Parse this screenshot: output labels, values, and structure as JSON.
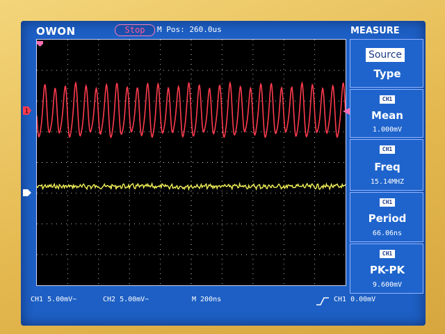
{
  "header": {
    "brand": "OWON",
    "run_state": "Stop",
    "m_pos": "M Pos: 260.0us",
    "mode_title": "MEASURE"
  },
  "menu": {
    "source": {
      "value": "Source",
      "label": "Type"
    },
    "items": [
      {
        "channel": "CH1",
        "label": "Mean",
        "value": "1.000mV"
      },
      {
        "channel": "CH1",
        "label": "Freq",
        "value": "15.14MHZ"
      },
      {
        "channel": "CH1",
        "label": "Period",
        "value": "66.06ns"
      },
      {
        "channel": "CH1",
        "label": "PK-PK",
        "value": "9.600mV"
      }
    ]
  },
  "footer": {
    "ch1_scale": "CH1 5.00mV~",
    "ch2_scale": "CH2 5.00mV~",
    "timebase": "M 200ns",
    "trigger": "CH1 0.00mV"
  },
  "markers": {
    "ch1_label": "1"
  },
  "colors": {
    "screen": "#1d5fc4",
    "ch1_trace": "#ff3b4e",
    "ch2_trace": "#f2f25a",
    "run_state": "#ff5a96",
    "trigger_marker": "#ff6eb5"
  }
}
